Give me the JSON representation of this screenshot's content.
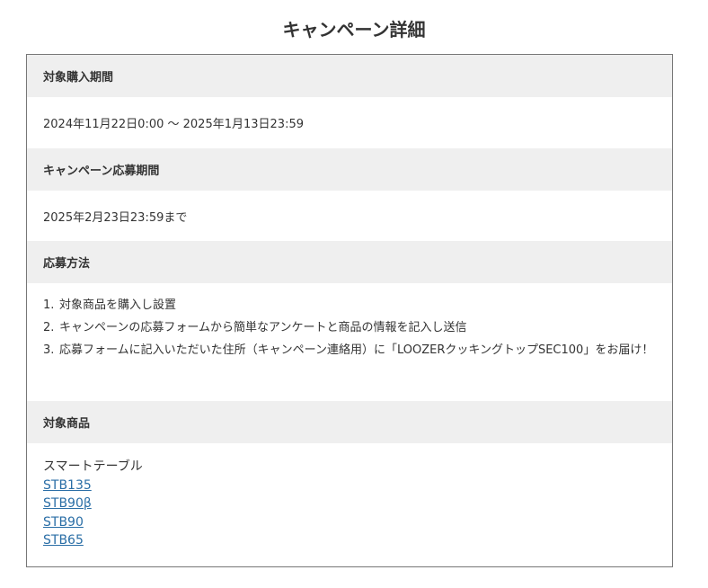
{
  "page": {
    "title": "キャンペーン詳細"
  },
  "sections": {
    "purchase_period": {
      "heading": "対象購入期間",
      "value": "2024年11月22日0:00 〜 2025年1月13日23:59"
    },
    "application_period": {
      "heading": "キャンペーン応募期間",
      "value": "2025年2月23日23:59まで"
    },
    "method": {
      "heading": "応募方法",
      "steps": [
        {
          "number": "1.",
          "text": "対象商品を購入し設置"
        },
        {
          "number": "2.",
          "text": "キャンペーンの応募フォームから簡単なアンケートと商品の情報を記入し送信"
        },
        {
          "number": "3.",
          "text": "応募フォームに記入いただいた住所（キャンペーン連絡用）に「LOOZERクッキングトップSEC100」をお届け！"
        }
      ]
    },
    "products": {
      "heading": "対象商品",
      "category": "スマートテーブル",
      "links": [
        "STB135",
        "STB90β",
        "STB90",
        "STB65"
      ]
    }
  },
  "colors": {
    "header_bg": "#efefef",
    "border": "#777777",
    "text": "#333333",
    "link": "#2a6ea6"
  }
}
